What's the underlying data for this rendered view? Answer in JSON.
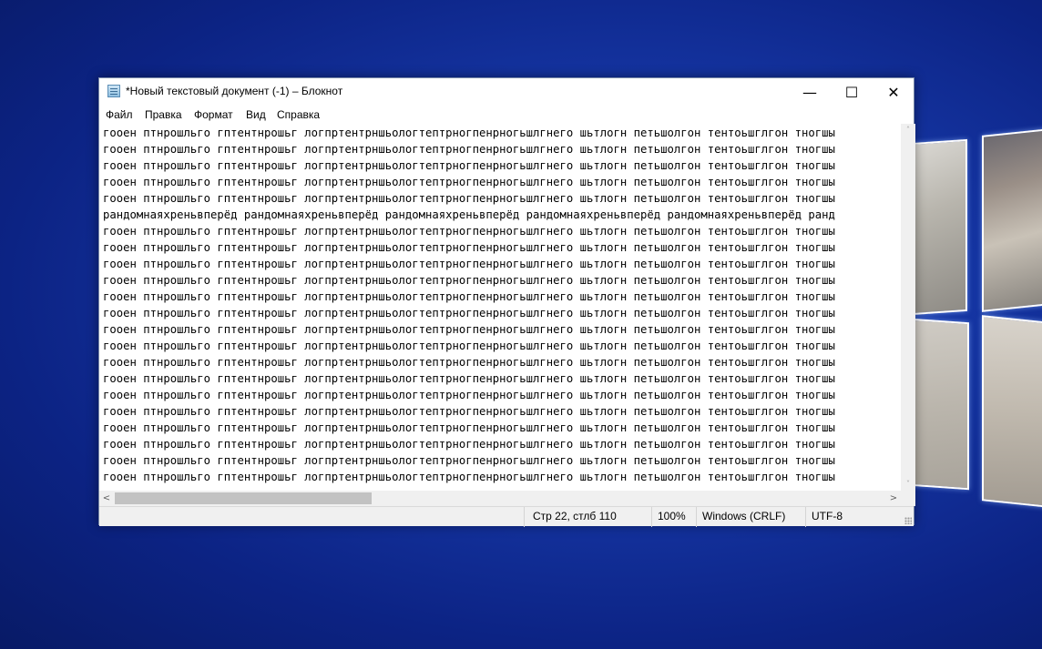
{
  "window": {
    "title": "*Новый текстовый документ (-1) – Блокнот",
    "controls": {
      "minimize": "—",
      "maximize": "☐",
      "close": "✕"
    }
  },
  "menu": {
    "file": "Файл",
    "edit": "Правка",
    "format": "Формат",
    "view": "Вид",
    "help": "Справка"
  },
  "editor": {
    "lines": [
      "гооен птнрошльго гптентнрошьг логпртентрншьологтептрногпенрногьшлгнего шьтлогн петьшолгон тентоьшглгон тногшы",
      "гооен птнрошльго гптентнрошьг логпртентрншьологтептрногпенрногьшлгнего шьтлогн петьшолгон тентоьшглгон тногшы",
      "гооен птнрошльго гптентнрошьг логпртентрншьологтептрногпенрногьшлгнего шьтлогн петьшолгон тентоьшглгон тногшы",
      "гооен птнрошльго гптентнрошьг логпртентрншьологтептрногпенрногьшлгнего шьтлогн петьшолгон тентоьшглгон тногшы",
      "гооен птнрошльго гптентнрошьг логпртентрншьологтептрногпенрногьшлгнего шьтлогн петьшолгон тентоьшглгон тногшы",
      "рандомнаяхреньвперёд рандомнаяхреньвперёд рандомнаяхреньвперёд рандомнаяхреньвперёд рандомнаяхреньвперёд ранд",
      "гооен птнрошльго гптентнрошьг логпртентрншьологтептрногпенрногьшлгнего шьтлогн петьшолгон тентоьшглгон тногшы",
      "гооен птнрошльго гптентнрошьг логпртентрншьологтептрногпенрногьшлгнего шьтлогн петьшолгон тентоьшглгон тногшы",
      "гооен птнрошльго гптентнрошьг логпртентрншьологтептрногпенрногьшлгнего шьтлогн петьшолгон тентоьшглгон тногшы",
      "гооен птнрошльго гптентнрошьг логпртентрншьологтептрногпенрногьшлгнего шьтлогн петьшолгон тентоьшглгон тногшы",
      "гооен птнрошльго гптентнрошьг логпртентрншьологтептрногпенрногьшлгнего шьтлогн петьшолгон тентоьшглгон тногшы",
      "гооен птнрошльго гптентнрошьг логпртентрншьологтептрногпенрногьшлгнего шьтлогн петьшолгон тентоьшглгон тногшы",
      "гооен птнрошльго гптентнрошьг логпртентрншьологтептрногпенрногьшлгнего шьтлогн петьшолгон тентоьшглгон тногшы",
      "гооен птнрошльго гптентнрошьг логпртентрншьологтептрногпенрногьшлгнего шьтлогн петьшолгон тентоьшглгон тногшы",
      "гооен птнрошльго гптентнрошьг логпртентрншьологтептрногпенрногьшлгнего шьтлогн петьшолгон тентоьшглгон тногшы",
      "гооен птнрошльго гптентнрошьг логпртентрншьологтептрногпенрногьшлгнего шьтлогн петьшолгон тентоьшглгон тногшы",
      "гооен птнрошльго гптентнрошьг логпртентрншьологтептрногпенрногьшлгнего шьтлогн петьшолгон тентоьшглгон тногшы",
      "гооен птнрошльго гптентнрошьг логпртентрншьологтептрногпенрногьшлгнего шьтлогн петьшолгон тентоьшглгон тногшы",
      "гооен птнрошльго гптентнрошьг логпртентрншьологтептрногпенрногьшлгнего шьтлогн петьшолгон тентоьшглгон тногшы",
      "гооен птнрошльго гптентнрошьг логпртентрншьологтептрногпенрногьшлгнего шьтлогн петьшолгон тентоьшглгон тногшы",
      "гооен птнрошльго гптентнрошьг логпртентрншьологтептрногпенрногьшлгнего шьтлогн петьшолгон тентоьшглгон тногшы",
      "гооен птнрошльго гптентнрошьг логпртентрншьологтептрногпенрногьшлгнего шьтлогн петьшолгон тентоьшглгон тногшы"
    ]
  },
  "scroll": {
    "up": "˄",
    "down": "˅",
    "left": "<",
    "right": ">"
  },
  "status": {
    "position": "Стр 22, стлб 110",
    "zoom": "100%",
    "line_ending": "Windows (CRLF)",
    "encoding": "UTF-8"
  }
}
